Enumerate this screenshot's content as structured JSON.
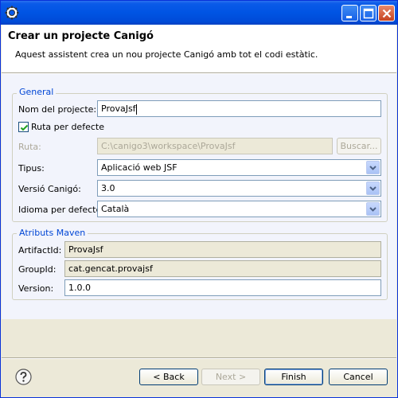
{
  "window": {
    "controls": {
      "minimize": "minimize-icon",
      "maximize": "maximize-icon",
      "close": "close-icon"
    }
  },
  "header": {
    "title": "Crear un projecte Canigó",
    "description": "Aquest assistent crea un nou projecte Canigó amb tot el codi estàtic."
  },
  "general": {
    "legend": "General",
    "project_name": {
      "label": "Nom del projecte:",
      "value": "ProvaJsf"
    },
    "default_path": {
      "label": "Ruta per defecte",
      "checked": true
    },
    "path": {
      "label": "Ruta:",
      "value": "C:\\canigo3\\workspace\\ProvaJsf",
      "browse": "Buscar..."
    },
    "type": {
      "label": "Tipus:",
      "value": "Aplicació web JSF"
    },
    "version": {
      "label": "Versió Canigó:",
      "value": "3.0"
    },
    "language": {
      "label": "Idioma per defecte:",
      "value": "Català"
    }
  },
  "maven": {
    "legend": "Atributs Maven",
    "artifact_id": {
      "label": "ArtifactId:",
      "value": "ProvaJsf"
    },
    "group_id": {
      "label": "GroupId:",
      "value": "cat.gencat.provajsf"
    },
    "version": {
      "label": "Version:",
      "value": "1.0.0"
    }
  },
  "footer": {
    "help_icon": "help-icon",
    "back": "< Back",
    "next": "Next >",
    "finish": "Finish",
    "cancel": "Cancel"
  }
}
